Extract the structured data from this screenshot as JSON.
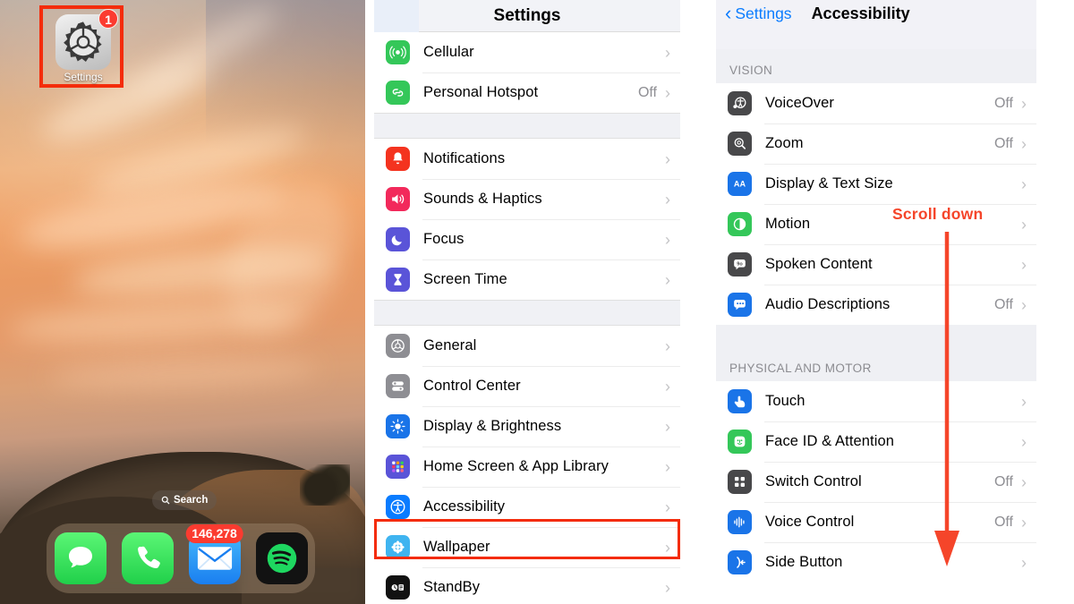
{
  "home_screen": {
    "app": {
      "label": "Settings",
      "badge": "1",
      "icon": "settings-gear-icon"
    },
    "search_pill": {
      "label": "Search",
      "icon": "search-icon"
    },
    "dock": [
      {
        "name": "messages",
        "icon": "messages-icon",
        "badge": ""
      },
      {
        "name": "phone",
        "icon": "phone-icon",
        "badge": ""
      },
      {
        "name": "mail",
        "icon": "mail-icon",
        "badge": "146,278"
      },
      {
        "name": "spotify",
        "icon": "spotify-icon",
        "badge": ""
      }
    ]
  },
  "settings_panel": {
    "title": "Settings",
    "highlighted_row": "Accessibility",
    "groups": [
      {
        "rows": [
          {
            "label": "Cellular",
            "value": "",
            "icon": "cellular-icon",
            "color": "#34c759"
          },
          {
            "label": "Personal Hotspot",
            "value": "Off",
            "icon": "hotspot-icon",
            "color": "#34c759"
          }
        ]
      },
      {
        "rows": [
          {
            "label": "Notifications",
            "value": "",
            "icon": "notifications-bell-icon",
            "color": "#f4331f"
          },
          {
            "label": "Sounds & Haptics",
            "value": "",
            "icon": "sounds-speaker-icon",
            "color": "#f2295b"
          },
          {
            "label": "Focus",
            "value": "",
            "icon": "focus-moon-icon",
            "color": "#5a54d8"
          },
          {
            "label": "Screen Time",
            "value": "",
            "icon": "screen-time-hourglass-icon",
            "color": "#5a54d8"
          }
        ]
      },
      {
        "rows": [
          {
            "label": "General",
            "value": "",
            "icon": "general-gear-icon",
            "color": "#8e8e93"
          },
          {
            "label": "Control Center",
            "value": "",
            "icon": "control-center-icon",
            "color": "#8e8e93"
          },
          {
            "label": "Display & Brightness",
            "value": "",
            "icon": "display-brightness-icon",
            "color": "#1a74e8"
          },
          {
            "label": "Home Screen & App Library",
            "value": "",
            "icon": "home-screen-grid-icon",
            "color": "#5a54d8"
          },
          {
            "label": "Accessibility",
            "value": "",
            "icon": "accessibility-icon",
            "color": "#0a7cff"
          },
          {
            "label": "Wallpaper",
            "value": "",
            "icon": "wallpaper-flower-icon",
            "color": "#3fb4f0"
          },
          {
            "label": "StandBy",
            "value": "",
            "icon": "standby-icon",
            "color": "#111111"
          }
        ]
      }
    ]
  },
  "accessibility_panel": {
    "back_label": "Settings",
    "title": "Accessibility",
    "annotation": {
      "text": "Scroll down",
      "color": "#f5452a",
      "direction": "down"
    },
    "sections": [
      {
        "header": "VISION",
        "rows": [
          {
            "label": "VoiceOver",
            "value": "Off",
            "icon": "voiceover-icon",
            "color": "#48484a"
          },
          {
            "label": "Zoom",
            "value": "Off",
            "icon": "zoom-magnifier-icon",
            "color": "#48484a"
          },
          {
            "label": "Display & Text Size",
            "value": "",
            "icon": "display-text-size-icon",
            "color": "#1a74e8"
          },
          {
            "label": "Motion",
            "value": "",
            "icon": "motion-icon",
            "color": "#34c759"
          },
          {
            "label": "Spoken Content",
            "value": "",
            "icon": "spoken-content-icon",
            "color": "#48484a"
          },
          {
            "label": "Audio Descriptions",
            "value": "Off",
            "icon": "audio-descriptions-icon",
            "color": "#1a74e8"
          }
        ]
      },
      {
        "header": "PHYSICAL AND MOTOR",
        "rows": [
          {
            "label": "Touch",
            "value": "",
            "icon": "touch-hand-icon",
            "color": "#1a74e8"
          },
          {
            "label": "Face ID & Attention",
            "value": "",
            "icon": "face-id-icon",
            "color": "#34c759"
          },
          {
            "label": "Switch Control",
            "value": "Off",
            "icon": "switch-control-icon",
            "color": "#48484a"
          },
          {
            "label": "Voice Control",
            "value": "Off",
            "icon": "voice-control-icon",
            "color": "#1a74e8"
          },
          {
            "label": "Side Button",
            "value": "",
            "icon": "side-button-icon",
            "color": "#1a74e8"
          }
        ]
      }
    ]
  }
}
